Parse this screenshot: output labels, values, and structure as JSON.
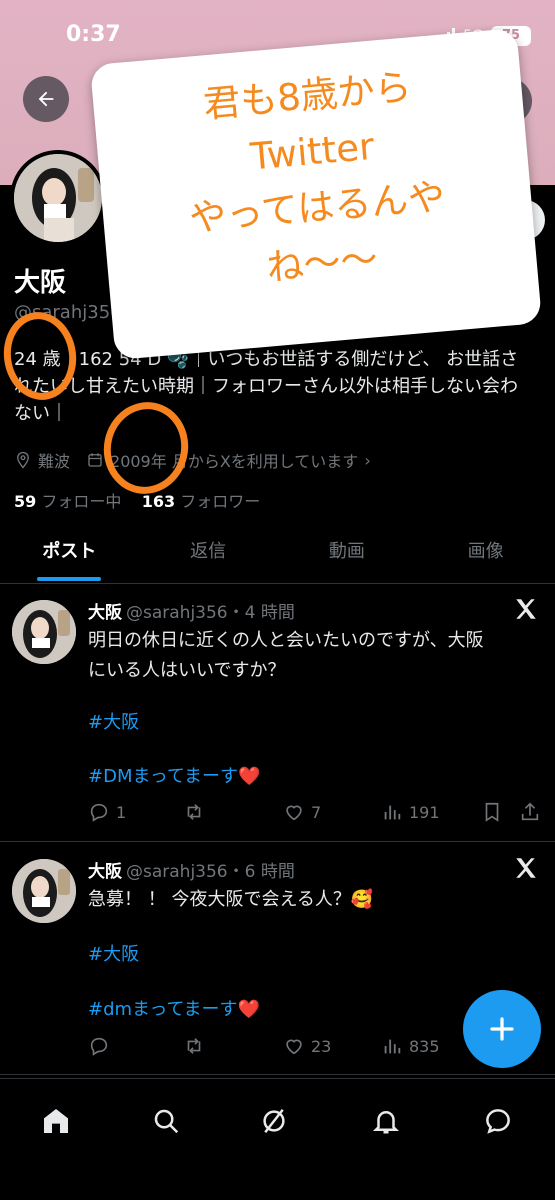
{
  "status_bar": {
    "time": "0:37",
    "network": "5G",
    "battery": "75"
  },
  "profile": {
    "display_name": "大阪",
    "handle": "@sarahj356",
    "bio": "24 歳　162 54 D 🫧｜いつもお世話する側だけど、 お世話されたいし甘えたい時期｜フォロワーさん以外は相手しない会わない｜",
    "location": "難波",
    "joined": "2009年 月からXを利用しています",
    "following_count": "59",
    "following_label": "フォロー中",
    "followers_count": "163",
    "followers_label": "フォロワー"
  },
  "tabs": [
    {
      "label": "ポスト"
    },
    {
      "label": "返信"
    },
    {
      "label": "動画"
    },
    {
      "label": "画像"
    }
  ],
  "posts": [
    {
      "name": "大阪",
      "meta": "@sarahj356・4 時間",
      "line1": "明日の休日に近くの人と会いたいのですが、大阪",
      "line2": "にいる人はいいですか？",
      "hashtag1": "#大阪",
      "hashtag2": "#DMまってまーす❤️",
      "replies": "1",
      "reposts": "",
      "likes": "7",
      "views": "191"
    },
    {
      "name": "大阪",
      "meta": "@sarahj356・6 時間",
      "line1": "急募！ ！ 今夜大阪で会える人？🥰",
      "hashtag1": "#大阪",
      "hashtag2": "#dmまってまーす❤️",
      "replies": "",
      "reposts": "",
      "likes": "23",
      "views": "835"
    }
  ],
  "overlay": {
    "sticker_lines": [
      "君も8歳から",
      "Twitter",
      "やってはるんや",
      "ね〜〜"
    ]
  },
  "colors": {
    "accent": "#1d9bf0",
    "annotation": "#f5821f",
    "banner": "#e2b3c4"
  }
}
